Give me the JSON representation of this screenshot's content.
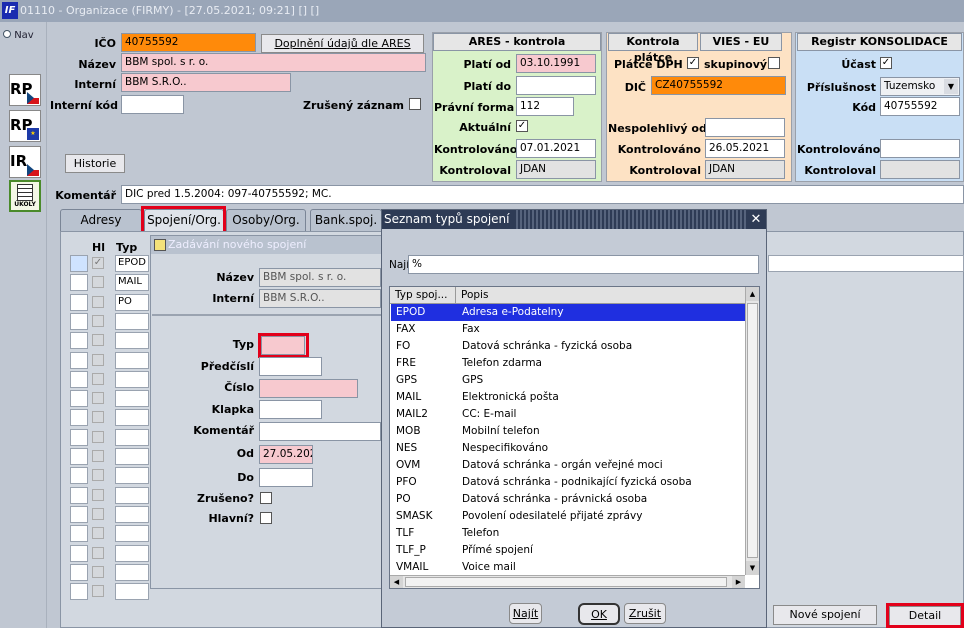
{
  "window": {
    "title": "01110 - Organizace (FIRMY) - [27.05.2021; 09:21] [] []"
  },
  "sidebar": {
    "nav_label": "Nav",
    "icons": [
      {
        "label": "RP"
      },
      {
        "label": "RP"
      },
      {
        "label": "IR"
      },
      {
        "label": "ÚKOLY"
      }
    ]
  },
  "form": {
    "ico_label": "IČO",
    "ico_value": "40755592",
    "ares_button": "Doplnění údajů dle ARES",
    "nazev_label": "Název",
    "nazev_value": "BBM spol. s r. o.",
    "interni_label": "Interní",
    "interni_value": "BBM S.R.O..",
    "interni_kod_label": "Interní kód",
    "interni_kod_value": "",
    "zruseny_label": "Zrušený záznam",
    "historie_button": "Historie",
    "komentar_label": "Komentář",
    "komentar_value": "DIC pred 1.5.2004: 097-40755592; MC."
  },
  "ares": {
    "title": "ARES - kontrola",
    "plati_od_label": "Platí od",
    "plati_od_value": "03.10.1991",
    "plati_do_label": "Platí do",
    "plati_do_value": "",
    "pravni_forma_label": "Právní forma",
    "pravni_forma_value": "112",
    "aktualni_label": "Aktuální",
    "aktualni_checked": "✓",
    "kontrolovano_label": "Kontrolováno",
    "kontrolovano_value": "07.01.2021",
    "kontroloval_label": "Kontroloval",
    "kontroloval_value": "JDAN"
  },
  "platce": {
    "title": "Kontrola plátce",
    "vies_title": "VIES - EU",
    "platce_dph_label": "Plátce DPH",
    "platce_dph_checked": "✓",
    "skupinovy_label": "skupinový",
    "dic_label": "DIČ",
    "dic_value": "CZ40755592",
    "nespolehlivy_label": "Nespolehlivý od",
    "nespolehlivy_value": "",
    "kontrolovano_label": "Kontrolováno",
    "kontrolovano_value": "26.05.2021",
    "kontroloval_label": "Kontroloval",
    "kontroloval_value": "JDAN"
  },
  "konsolidace": {
    "title": "Registr KONSOLIDACE",
    "ucast_label": "Účast",
    "ucast_checked": "✓",
    "prislusnost_label": "Příslušnost",
    "prislusnost_value": "Tuzemsko",
    "kod_label": "Kód",
    "kod_value": "40755592",
    "kontrolovano_label": "Kontrolováno",
    "kontrolovano_value": "",
    "kontroloval_label": "Kontroloval",
    "kontroloval_value": ""
  },
  "tabs": [
    {
      "label": "Adresy"
    },
    {
      "label": "Spojení/Org."
    },
    {
      "label": "Osoby/Org."
    },
    {
      "label": "Bank.spoj."
    }
  ],
  "grid": {
    "col_hl": "Hl",
    "col_typ": "Typ",
    "rows": [
      {
        "typ": "EPOD",
        "checked": "✓"
      },
      {
        "typ": "MAIL",
        "checked": ""
      },
      {
        "typ": "PO",
        "checked": ""
      }
    ]
  },
  "new_conn": {
    "title": "Zadávání nového spojení",
    "nazev_label": "Název",
    "nazev_value": "BBM spol. s r. o.",
    "interni_label": "Interní",
    "interni_value": "BBM S.R.O..",
    "typ_label": "Typ",
    "predcisli_label": "Předčíslí",
    "cislo_label": "Číslo",
    "klapka_label": "Klapka",
    "komentar_label": "Komentář",
    "od_label": "Od",
    "od_value": "27.05.202",
    "do_label": "Do",
    "zruseno_label": "Zrušeno?",
    "hlavni_label": "Hlavní?"
  },
  "dialog": {
    "title": "Seznam typů spojení",
    "find_label": "Najít",
    "find_value": "%",
    "col_code": "Typ spoj...",
    "col_desc": "Popis",
    "items": [
      {
        "code": "EPOD",
        "desc": "Adresa e-Podatelny"
      },
      {
        "code": "FAX",
        "desc": "Fax"
      },
      {
        "code": "FO",
        "desc": "Datová schránka - fyzická osoba"
      },
      {
        "code": "FRE",
        "desc": "Telefon zdarma"
      },
      {
        "code": "GPS",
        "desc": "GPS"
      },
      {
        "code": "MAIL",
        "desc": "Elektronická pošta"
      },
      {
        "code": "MAIL2",
        "desc": "CC: E-mail"
      },
      {
        "code": "MOB",
        "desc": "Mobilní telefon"
      },
      {
        "code": "NES",
        "desc": "Nespecifikováno"
      },
      {
        "code": "OVM",
        "desc": "Datová schránka - orgán veřejné moci"
      },
      {
        "code": "PFO",
        "desc": "Datová schránka - podnikající fyzická osoba"
      },
      {
        "code": "PO",
        "desc": "Datová schránka - právnická osoba"
      },
      {
        "code": "SMASK",
        "desc": "Povolení odesilatelé přijaté zprávy"
      },
      {
        "code": "TLF",
        "desc": "Telefon"
      },
      {
        "code": "TLF_P",
        "desc": "Přímé spojení"
      },
      {
        "code": "VMAIL",
        "desc": "Voice mail"
      }
    ],
    "find_button": "Najít",
    "ok_button": "OK",
    "cancel_button": "Zrušit"
  },
  "bottom": {
    "nove_spojeni": "Nové spojení",
    "detail": "Detail"
  },
  "colors": {
    "selection": "#1f2fe0",
    "required": "#f7c9cf",
    "highlight_outline": "#e2001a",
    "ares_panel": "#d9f2c9",
    "platce_panel": "#fde2c4",
    "konsolidace_panel": "#c9dff5"
  }
}
